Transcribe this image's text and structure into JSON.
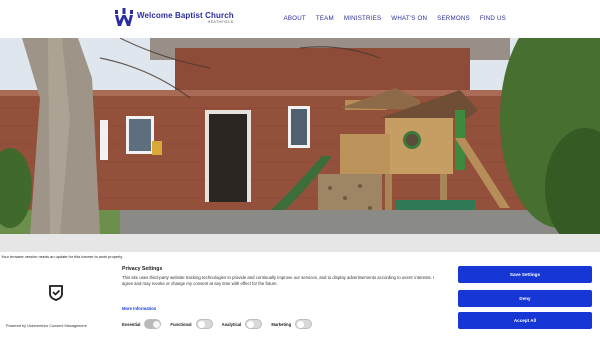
{
  "brand": {
    "name": "Welcome Baptist Church",
    "subtitle": "HEATHFIELD",
    "color": "#2b2f9e"
  },
  "nav": {
    "items": [
      {
        "label": "ABOUT"
      },
      {
        "label": "TEAM"
      },
      {
        "label": "MINISTRIES"
      },
      {
        "label": "WHAT'S ON"
      },
      {
        "label": "SERMONS"
      },
      {
        "label": "FIND US"
      }
    ]
  },
  "notice": {
    "update_text": "Your browser version needs an update for this banner to work properly."
  },
  "consent": {
    "powered_by": "Powered by Usercentrics Consent Management",
    "title": "Privacy Settings",
    "body": "This site uses third-party website tracking technologies to provide and continually improve our services, and to display advertisements according to users' interests. I agree and may revoke or change my consent at any time with effect for the future.",
    "more_info": "More Information",
    "toggles": [
      {
        "label": "Essential",
        "on": true
      },
      {
        "label": "Functional",
        "on": false
      },
      {
        "label": "Analytical",
        "on": false
      },
      {
        "label": "Marketing",
        "on": false
      }
    ],
    "buttons": {
      "save": "Save Settings",
      "deny": "Deny",
      "accept": "Accept All"
    },
    "button_color": "#1636d6"
  }
}
